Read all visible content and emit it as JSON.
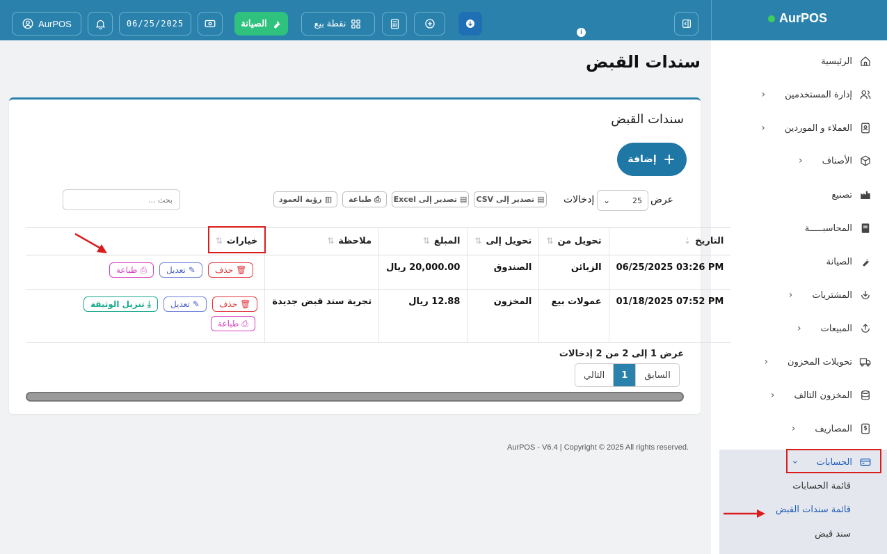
{
  "header": {
    "user_label": "AurPOS",
    "date": "06/25/2025",
    "maintenance_label": "الصيانة",
    "pos_label": "نقطة بيع",
    "info_badge": "i"
  },
  "brand": {
    "name": "AurPOS"
  },
  "sidebar": {
    "items": [
      {
        "label": "الرئيسية"
      },
      {
        "label": "إدارة المستخدمين"
      },
      {
        "label": "العملاء و الموردين"
      },
      {
        "label": "الأصناف"
      },
      {
        "label": "تصنيع"
      },
      {
        "label": "المحاسبـــــة"
      },
      {
        "label": "الصيانة"
      },
      {
        "label": "المشتريات"
      },
      {
        "label": "المبيعات"
      },
      {
        "label": "تحويلات المخزون"
      },
      {
        "label": "المخزون التالف"
      },
      {
        "label": "المصاريف"
      },
      {
        "label": "الحسابات"
      }
    ],
    "sub_items": [
      {
        "label": "قائمة الحسابات"
      },
      {
        "label": "قائمة سندات القبض"
      },
      {
        "label": "سند قبض"
      }
    ]
  },
  "page": {
    "title": "سندات القبض"
  },
  "card": {
    "title": "سندات القبض",
    "add_label": "إضافة",
    "show_label": "عرض",
    "entries_label": "إدخالات",
    "page_length": "25",
    "export_csv": "تصدير إلى CSV",
    "export_excel": "تصدير إلى Excel",
    "print": "طباعة",
    "column_visibility": "رؤية العمود",
    "search_placeholder": "بحث ..."
  },
  "table": {
    "headers": [
      "التاريخ",
      "تحويل من",
      "تحويل إلى",
      "المبلغ",
      "ملاحظة",
      "خيارات"
    ],
    "rows": [
      {
        "date": "06/25/2025 03:26 PM",
        "from": "الزبائن",
        "to": "الصندوق",
        "amount": "20,000.00 ريال",
        "note": ""
      },
      {
        "date": "01/18/2025 07:52 PM",
        "from": "عمولات بيع",
        "to": "المخزون",
        "amount": "12.88 ريال",
        "note": "تجربة سند قبض جديدة"
      }
    ],
    "actions": {
      "delete": "حذف",
      "edit": "تعديل",
      "print": "طباعة",
      "download": "تنزيل الوثيقة"
    }
  },
  "pagination": {
    "info": "عرض 1 إلى 2 من 2 إدخالات",
    "previous": "السابق",
    "current": "1",
    "next": "التالي"
  },
  "footer": {
    "text": "AurPOS - V6.4 | Copyright © 2025 All rights reserved."
  },
  "colors": {
    "primary": "#2a82ac",
    "green": "#2ec27e",
    "annotation": "#d91c1c"
  }
}
